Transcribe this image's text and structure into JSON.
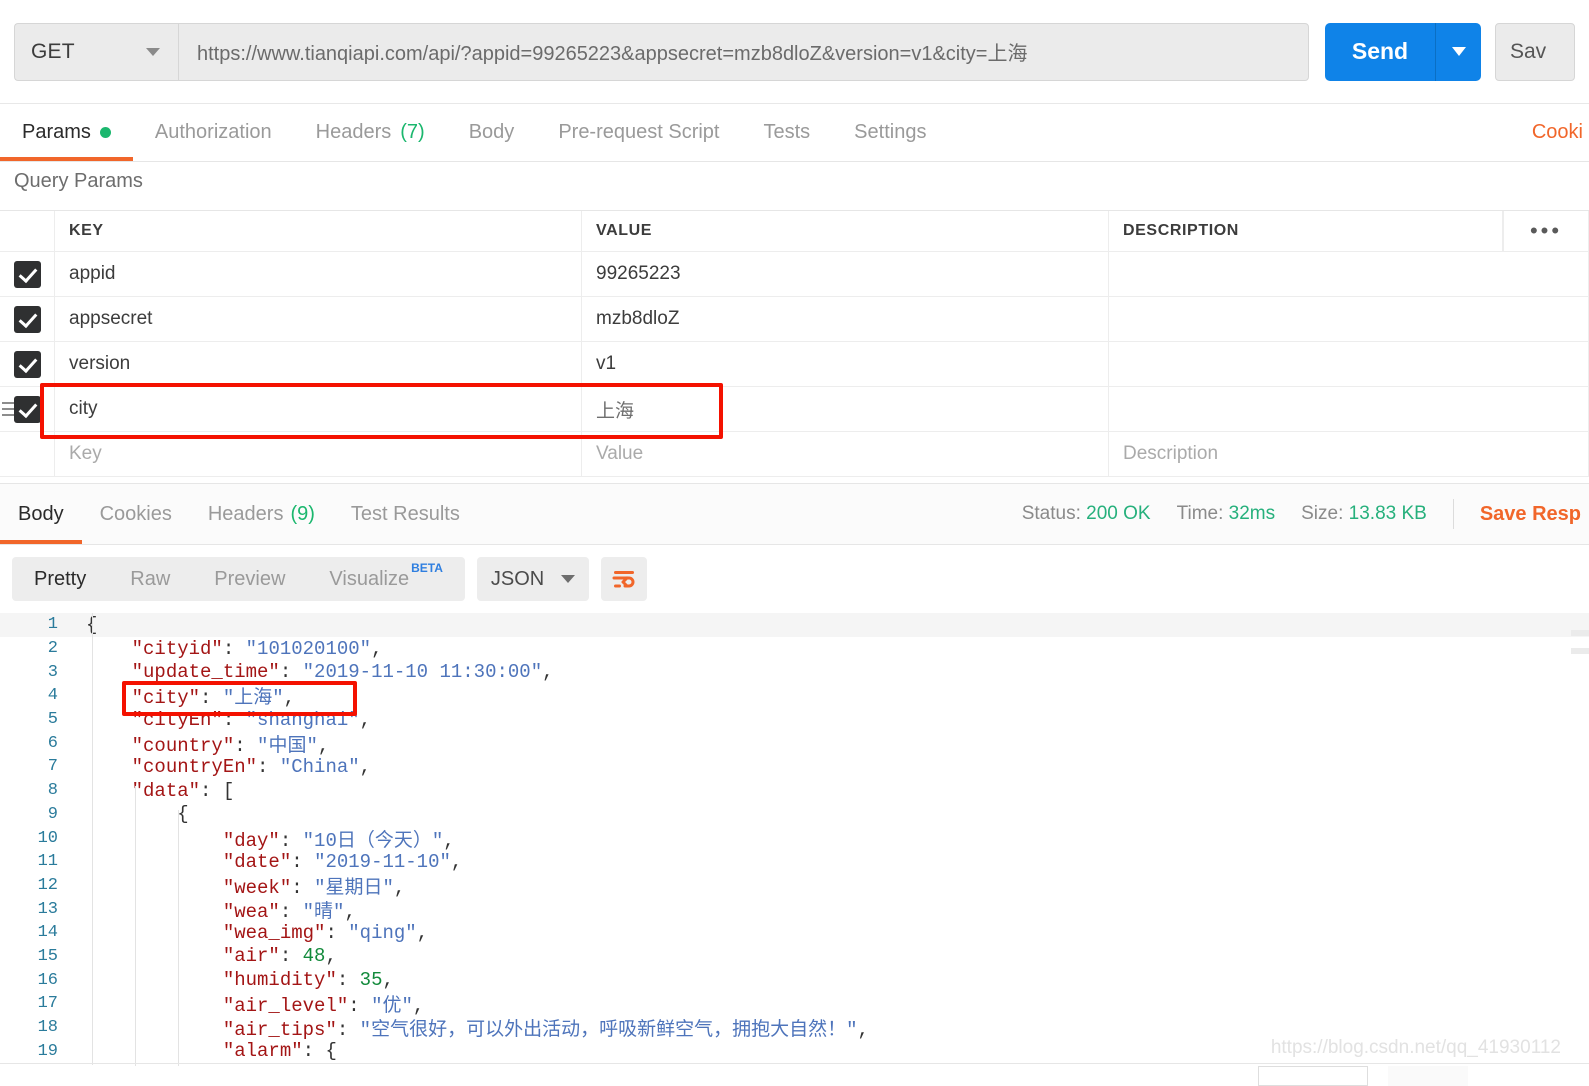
{
  "request": {
    "method": "GET",
    "method_caret": "chevron-down",
    "url": "https://www.tianqiapi.com/api/?appid=99265223&appsecret=mzb8dloZ&version=v1&city=上海",
    "send_label": "Send",
    "save_label": "Sav"
  },
  "request_tabs": [
    {
      "label": "Params",
      "badge": "",
      "dot": true,
      "active": true
    },
    {
      "label": "Authorization",
      "badge": "",
      "dot": false,
      "active": false
    },
    {
      "label": "Headers",
      "badge": "(7)",
      "dot": false,
      "active": false
    },
    {
      "label": "Body",
      "badge": "",
      "dot": false,
      "active": false
    },
    {
      "label": "Pre-request Script",
      "badge": "",
      "dot": false,
      "active": false
    },
    {
      "label": "Tests",
      "badge": "",
      "dot": false,
      "active": false
    },
    {
      "label": "Settings",
      "badge": "",
      "dot": false,
      "active": false
    }
  ],
  "cookies_link": "Cooki",
  "query_params": {
    "title": "Query Params",
    "columns": {
      "key": "KEY",
      "value": "VALUE",
      "description": "DESCRIPTION",
      "more": "•••"
    },
    "rows": [
      {
        "checked": true,
        "key": "appid",
        "value": "99265223",
        "description": "",
        "highlighted": false,
        "handle": false
      },
      {
        "checked": true,
        "key": "appsecret",
        "value": "mzb8dloZ",
        "description": "",
        "highlighted": false,
        "handle": false
      },
      {
        "checked": true,
        "key": "version",
        "value": "v1",
        "description": "",
        "highlighted": false,
        "handle": false
      },
      {
        "checked": true,
        "key": "city",
        "value": "上海",
        "description": "",
        "highlighted": true,
        "handle": true
      }
    ],
    "empty_row": {
      "key": "Key",
      "value": "Value",
      "description": "Description"
    }
  },
  "response_tabs": [
    {
      "label": "Body",
      "badge": "",
      "active": true
    },
    {
      "label": "Cookies",
      "badge": "",
      "active": false
    },
    {
      "label": "Headers",
      "badge": "(9)",
      "active": false
    },
    {
      "label": "Test Results",
      "badge": "",
      "active": false
    }
  ],
  "response_meta": {
    "status_label": "Status:",
    "status_value": "200 OK",
    "time_label": "Time:",
    "time_value": "32ms",
    "size_label": "Size:",
    "size_value": "13.83 KB",
    "save_response": "Save Resp"
  },
  "format_bar": {
    "modes": [
      {
        "label": "Pretty",
        "active": true,
        "beta": ""
      },
      {
        "label": "Raw",
        "active": false,
        "beta": ""
      },
      {
        "label": "Preview",
        "active": false,
        "beta": ""
      },
      {
        "label": "Visualize",
        "active": false,
        "beta": "BETA"
      }
    ],
    "language": "JSON",
    "wrap_icon": "word-wrap-icon"
  },
  "code_lines": [
    {
      "n": 1,
      "indent": 0,
      "tokens": [
        {
          "t": "p",
          "v": "{"
        }
      ]
    },
    {
      "n": 2,
      "indent": 1,
      "tokens": [
        {
          "t": "k",
          "v": "\"cityid\""
        },
        {
          "t": "p",
          "v": ": "
        },
        {
          "t": "s",
          "v": "\"101020100\""
        },
        {
          "t": "p",
          "v": ","
        }
      ]
    },
    {
      "n": 3,
      "indent": 1,
      "tokens": [
        {
          "t": "k",
          "v": "\"update_time\""
        },
        {
          "t": "p",
          "v": ": "
        },
        {
          "t": "s",
          "v": "\"2019-11-10 11:30:00\""
        },
        {
          "t": "p",
          "v": ","
        }
      ]
    },
    {
      "n": 4,
      "indent": 1,
      "tokens": [
        {
          "t": "k",
          "v": "\"city\""
        },
        {
          "t": "p",
          "v": ": "
        },
        {
          "t": "s",
          "v": "\"上海\""
        },
        {
          "t": "p",
          "v": ","
        }
      ]
    },
    {
      "n": 5,
      "indent": 1,
      "tokens": [
        {
          "t": "k",
          "v": "\"cityEn\""
        },
        {
          "t": "p",
          "v": ": "
        },
        {
          "t": "s",
          "v": "\"shanghai\""
        },
        {
          "t": "p",
          "v": ","
        }
      ]
    },
    {
      "n": 6,
      "indent": 1,
      "tokens": [
        {
          "t": "k",
          "v": "\"country\""
        },
        {
          "t": "p",
          "v": ": "
        },
        {
          "t": "s",
          "v": "\"中国\""
        },
        {
          "t": "p",
          "v": ","
        }
      ]
    },
    {
      "n": 7,
      "indent": 1,
      "tokens": [
        {
          "t": "k",
          "v": "\"countryEn\""
        },
        {
          "t": "p",
          "v": ": "
        },
        {
          "t": "s",
          "v": "\"China\""
        },
        {
          "t": "p",
          "v": ","
        }
      ]
    },
    {
      "n": 8,
      "indent": 1,
      "tokens": [
        {
          "t": "k",
          "v": "\"data\""
        },
        {
          "t": "p",
          "v": ": ["
        }
      ]
    },
    {
      "n": 9,
      "indent": 2,
      "tokens": [
        {
          "t": "p",
          "v": "{"
        }
      ]
    },
    {
      "n": 10,
      "indent": 3,
      "tokens": [
        {
          "t": "k",
          "v": "\"day\""
        },
        {
          "t": "p",
          "v": ": "
        },
        {
          "t": "s",
          "v": "\"10日（今天）\""
        },
        {
          "t": "p",
          "v": ","
        }
      ]
    },
    {
      "n": 11,
      "indent": 3,
      "tokens": [
        {
          "t": "k",
          "v": "\"date\""
        },
        {
          "t": "p",
          "v": ": "
        },
        {
          "t": "s",
          "v": "\"2019-11-10\""
        },
        {
          "t": "p",
          "v": ","
        }
      ]
    },
    {
      "n": 12,
      "indent": 3,
      "tokens": [
        {
          "t": "k",
          "v": "\"week\""
        },
        {
          "t": "p",
          "v": ": "
        },
        {
          "t": "s",
          "v": "\"星期日\""
        },
        {
          "t": "p",
          "v": ","
        }
      ]
    },
    {
      "n": 13,
      "indent": 3,
      "tokens": [
        {
          "t": "k",
          "v": "\"wea\""
        },
        {
          "t": "p",
          "v": ": "
        },
        {
          "t": "s",
          "v": "\"晴\""
        },
        {
          "t": "p",
          "v": ","
        }
      ]
    },
    {
      "n": 14,
      "indent": 3,
      "tokens": [
        {
          "t": "k",
          "v": "\"wea_img\""
        },
        {
          "t": "p",
          "v": ": "
        },
        {
          "t": "s",
          "v": "\"qing\""
        },
        {
          "t": "p",
          "v": ","
        }
      ]
    },
    {
      "n": 15,
      "indent": 3,
      "tokens": [
        {
          "t": "k",
          "v": "\"air\""
        },
        {
          "t": "p",
          "v": ": "
        },
        {
          "t": "n",
          "v": "48"
        },
        {
          "t": "p",
          "v": ","
        }
      ]
    },
    {
      "n": 16,
      "indent": 3,
      "tokens": [
        {
          "t": "k",
          "v": "\"humidity\""
        },
        {
          "t": "p",
          "v": ": "
        },
        {
          "t": "n",
          "v": "35"
        },
        {
          "t": "p",
          "v": ","
        }
      ]
    },
    {
      "n": 17,
      "indent": 3,
      "tokens": [
        {
          "t": "k",
          "v": "\"air_level\""
        },
        {
          "t": "p",
          "v": ": "
        },
        {
          "t": "s",
          "v": "\"优\""
        },
        {
          "t": "p",
          "v": ","
        }
      ]
    },
    {
      "n": 18,
      "indent": 3,
      "tokens": [
        {
          "t": "k",
          "v": "\"air_tips\""
        },
        {
          "t": "p",
          "v": ": "
        },
        {
          "t": "s",
          "v": "\"空气很好，可以外出活动，呼吸新鲜空气，拥抱大自然！\""
        },
        {
          "t": "p",
          "v": ","
        }
      ]
    },
    {
      "n": 19,
      "indent": 3,
      "tokens": [
        {
          "t": "k",
          "v": "\"alarm\""
        },
        {
          "t": "p",
          "v": ": {"
        }
      ]
    }
  ],
  "watermark": "https://blog.csdn.net/qq_41930112",
  "colors": {
    "accent_orange": "#f1662a",
    "send_blue": "#0f83e8",
    "status_green": "#26b07c",
    "annotation_red": "#f41100",
    "json_key": "#a31515",
    "json_string": "#4e74bb",
    "json_number": "#128a3b"
  }
}
